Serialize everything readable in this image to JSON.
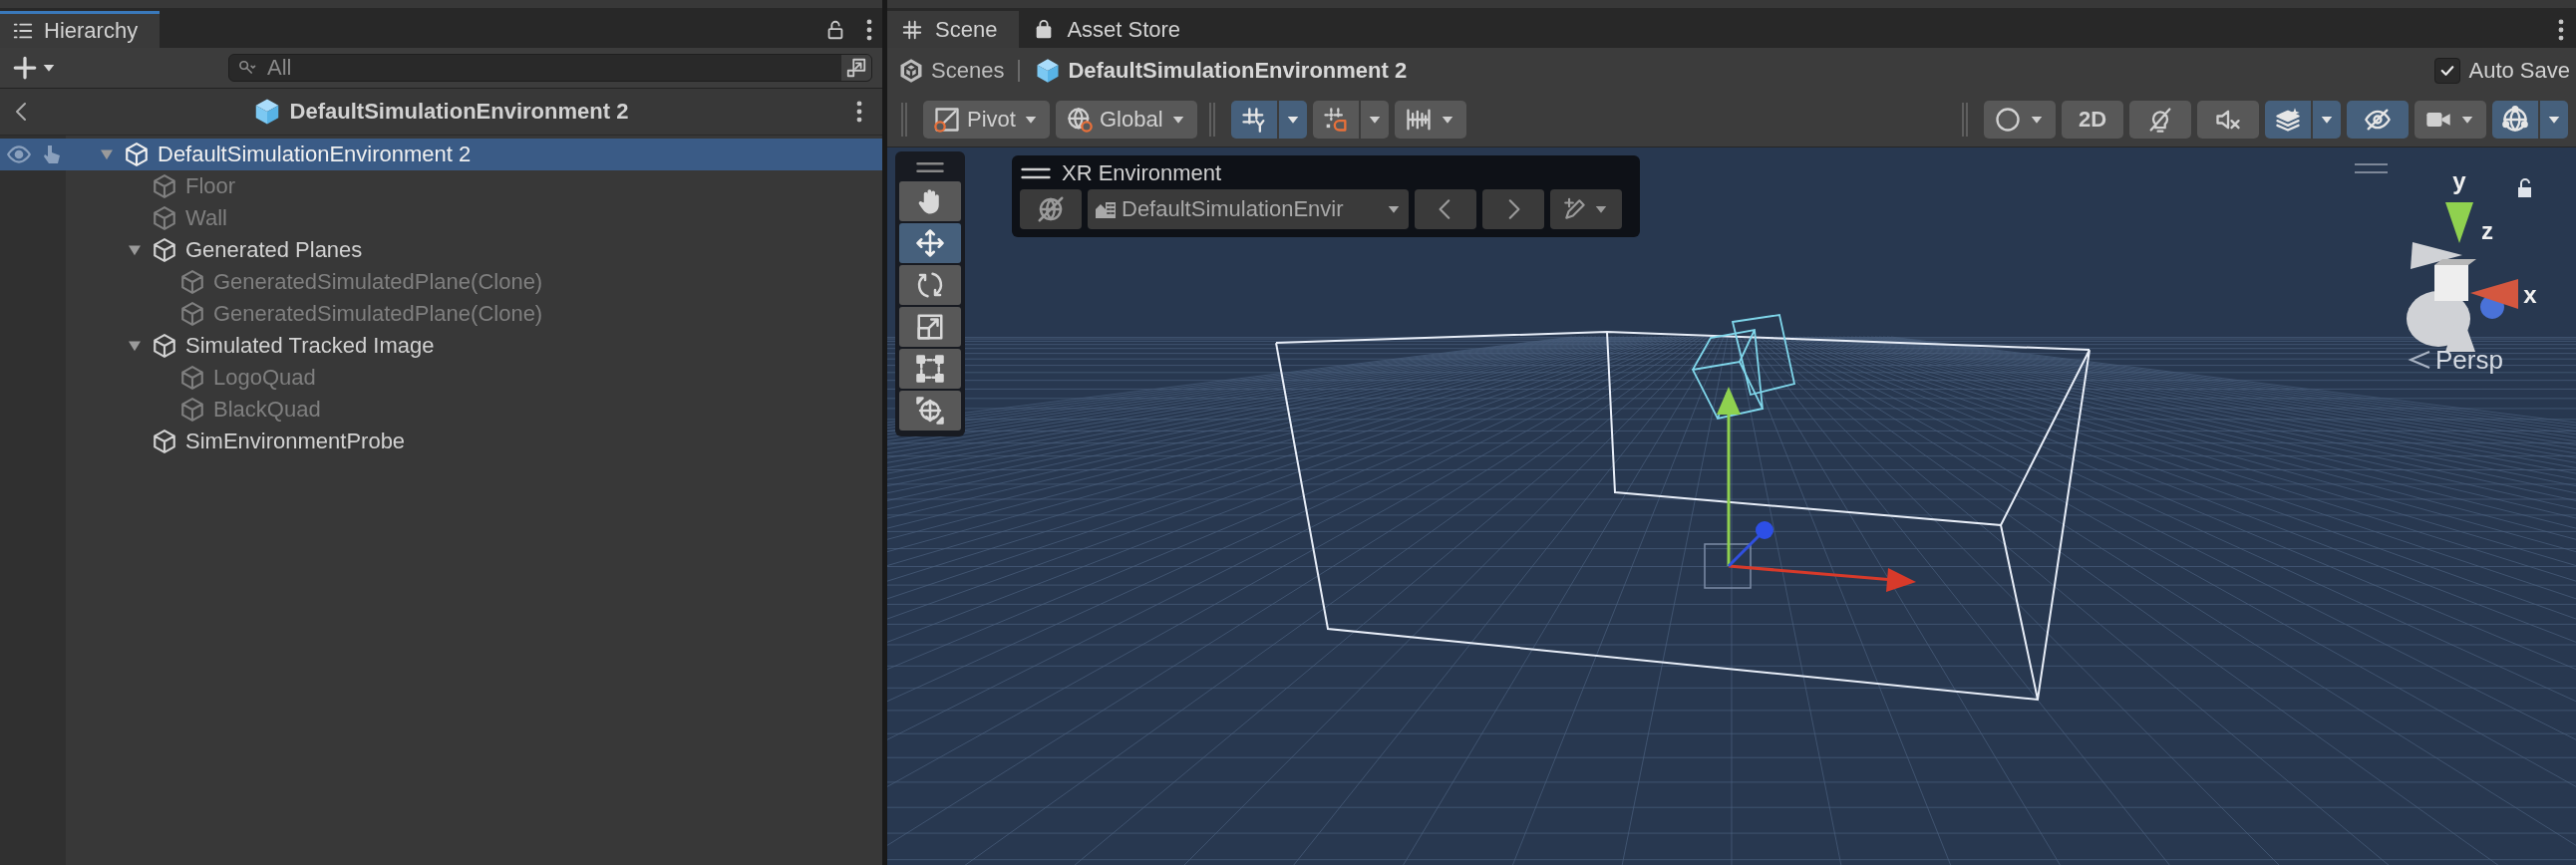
{
  "hierarchy": {
    "tab": {
      "label": "Hierarchy",
      "selected": true
    },
    "search": {
      "placeholder": "All"
    },
    "header": {
      "title": "DefaultSimulationEnvironment 2"
    },
    "items": [
      {
        "name": "DefaultSimulationEnvironment 2",
        "selected": true,
        "disabled": false,
        "expanded": true,
        "children": [
          {
            "name": "Floor",
            "selected": false,
            "disabled": true
          },
          {
            "name": "Wall",
            "selected": false,
            "disabled": true
          },
          {
            "name": "Generated Planes",
            "selected": false,
            "disabled": false,
            "expanded": true,
            "children": [
              {
                "name": "GeneratedSimulatedPlane(Clone)",
                "selected": false,
                "disabled": true
              },
              {
                "name": "GeneratedSimulatedPlane(Clone)",
                "selected": false,
                "disabled": true
              }
            ]
          },
          {
            "name": "Simulated Tracked Image",
            "selected": false,
            "disabled": false,
            "expanded": true,
            "children": [
              {
                "name": "LogoQuad",
                "selected": false,
                "disabled": true
              },
              {
                "name": "BlackQuad",
                "selected": false,
                "disabled": true
              }
            ]
          },
          {
            "name": "SimEnvironmentProbe",
            "selected": false,
            "disabled": false
          }
        ]
      }
    ]
  },
  "scene": {
    "tabs": [
      {
        "label": "Scene",
        "kind": "scene",
        "selected": true
      },
      {
        "label": "Asset Store",
        "kind": "store",
        "selected": false
      }
    ],
    "breadcrumbs": [
      {
        "label": "Scenes",
        "kind": "root"
      },
      {
        "label": "DefaultSimulationEnvironment 2",
        "kind": "prefab"
      }
    ],
    "auto_save": {
      "label": "Auto Save",
      "checked": true
    },
    "toolbar": {
      "left": [
        {
          "kind": "pivot",
          "label": "Pivot",
          "on": false,
          "dropdown": true
        },
        {
          "kind": "global",
          "label": "Global",
          "on": false,
          "dropdown": true
        },
        {
          "kind": "grid",
          "on": true,
          "dropdown": true
        },
        {
          "kind": "snap",
          "on": false,
          "dropdown": true
        },
        {
          "kind": "increment",
          "on": false,
          "dropdown": true
        }
      ],
      "right": [
        {
          "kind": "shading",
          "on": false,
          "dropdown": true
        },
        {
          "kind": "dimension",
          "label": "2D",
          "on": false,
          "dropdown": false
        },
        {
          "kind": "lighting",
          "on": false,
          "dropdown": false
        },
        {
          "kind": "audio",
          "on": false,
          "dropdown": false
        },
        {
          "kind": "effects",
          "on": true,
          "dropdown": true
        },
        {
          "kind": "visibility",
          "on": true,
          "dropdown": false
        },
        {
          "kind": "camera",
          "on": false,
          "dropdown": true
        },
        {
          "kind": "gizmos",
          "on": true,
          "dropdown": true
        }
      ]
    },
    "tools": [
      {
        "kind": "hand",
        "selected": false
      },
      {
        "kind": "move",
        "selected": true
      },
      {
        "kind": "rotate",
        "selected": false
      },
      {
        "kind": "scale",
        "selected": false
      },
      {
        "kind": "rect",
        "selected": false
      },
      {
        "kind": "transform",
        "selected": false
      }
    ],
    "xr_environment": {
      "title": "XR Environment",
      "on": false,
      "environment": "DefaultSimulationEnvir"
    },
    "gizmo": {
      "axes": [
        {
          "label": "y",
          "color": "#8fd14f"
        },
        {
          "label": "z",
          "color": "#4a72d8"
        },
        {
          "label": "x",
          "color": "#d4573f"
        }
      ],
      "projection": "Persp"
    }
  }
}
